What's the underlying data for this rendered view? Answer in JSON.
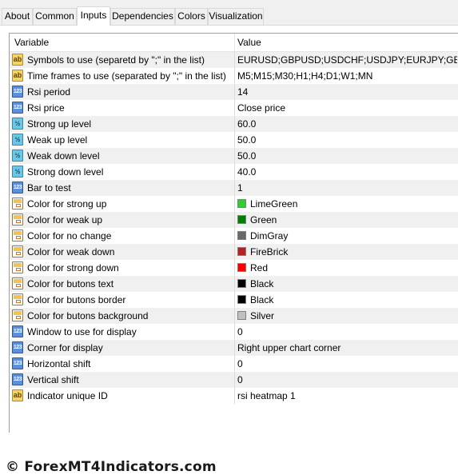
{
  "tabs": [
    "About",
    "Common",
    "Inputs",
    "Dependencies",
    "Colors",
    "Visualization"
  ],
  "active_tab": "Inputs",
  "table": {
    "header_variable": "Variable",
    "header_value": "Value",
    "rows": [
      {
        "icon": "ab-text-icon",
        "variable": "Symbols to use (separetd by \";\" in the list)",
        "value": "EURUSD;GBPUSD;USDCHF;USDJPY;EURJPY;GBPJ..."
      },
      {
        "icon": "ab-text-icon",
        "variable": "Time frames to use (separated by \";\" in the list)",
        "value": "M5;M15;M30;H1;H4;D1;W1;MN"
      },
      {
        "icon": "integer-123-icon",
        "variable": "Rsi period",
        "value": "14"
      },
      {
        "icon": "integer-123-icon",
        "variable": "Rsi price",
        "value": "Close price"
      },
      {
        "icon": "double-half-icon",
        "variable": "Strong up level",
        "value": "60.0"
      },
      {
        "icon": "double-half-icon",
        "variable": "Weak up level",
        "value": "50.0"
      },
      {
        "icon": "double-half-icon",
        "variable": "Weak down level",
        "value": "50.0"
      },
      {
        "icon": "double-half-icon",
        "variable": "Strong down level",
        "value": "40.0"
      },
      {
        "icon": "integer-123-icon",
        "variable": "Bar to test",
        "value": "1"
      },
      {
        "icon": "color-icon",
        "variable": "Color for strong up",
        "value": "LimeGreen",
        "swatch": "#32cd32"
      },
      {
        "icon": "color-icon",
        "variable": "Color for weak up",
        "value": "Green",
        "swatch": "#008000"
      },
      {
        "icon": "color-icon",
        "variable": "Color for no change",
        "value": "DimGray",
        "swatch": "#696969"
      },
      {
        "icon": "color-icon",
        "variable": "Color for weak down",
        "value": "FireBrick",
        "swatch": "#b22222"
      },
      {
        "icon": "color-icon",
        "variable": "Color for strong down",
        "value": "Red",
        "swatch": "#ff0000"
      },
      {
        "icon": "color-icon",
        "variable": "Color for butons text",
        "value": "Black",
        "swatch": "#000000"
      },
      {
        "icon": "color-icon",
        "variable": "Color for butons border",
        "value": "Black",
        "swatch": "#000000"
      },
      {
        "icon": "color-icon",
        "variable": "Color for butons background",
        "value": "Silver",
        "swatch": "#c0c0c0"
      },
      {
        "icon": "integer-123-icon",
        "variable": "Window to use for display",
        "value": "0"
      },
      {
        "icon": "integer-123-icon",
        "variable": "Corner for display",
        "value": "Right upper chart corner"
      },
      {
        "icon": "integer-123-icon",
        "variable": "Horizontal shift",
        "value": "0"
      },
      {
        "icon": "integer-123-icon",
        "variable": "Vertical shift",
        "value": "0"
      },
      {
        "icon": "ab-text-icon",
        "variable": "Indicator unique ID",
        "value": "rsi heatmap 1"
      }
    ]
  },
  "watermark": "© ForexMT4Indicators.com"
}
